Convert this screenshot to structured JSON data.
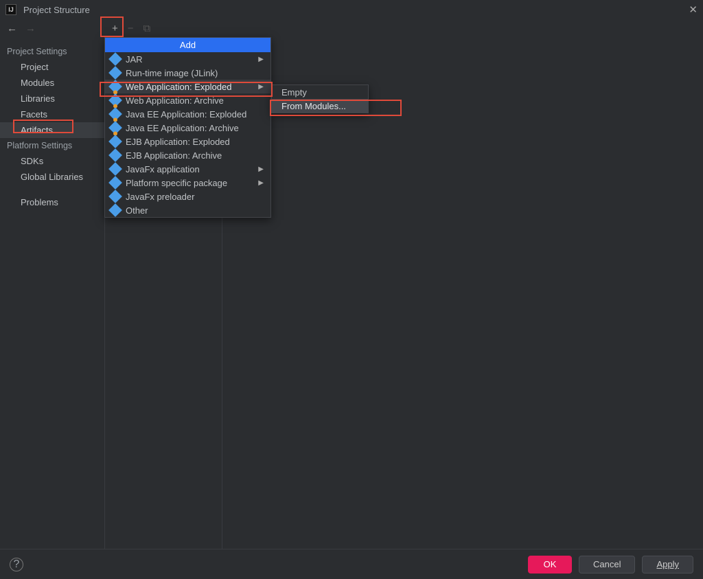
{
  "title": "Project Structure",
  "sidebar": {
    "heading1": "Project Settings",
    "heading2": "Platform Settings",
    "items1": [
      "Project",
      "Modules",
      "Libraries",
      "Facets",
      "Artifacts"
    ],
    "items2": [
      "SDKs",
      "Global Libraries"
    ],
    "problems": "Problems",
    "active": "Artifacts"
  },
  "menu": {
    "header": "Add",
    "items": [
      {
        "label": "JAR",
        "arrow": true,
        "orange": false
      },
      {
        "label": "Run-time image (JLink)",
        "arrow": false,
        "orange": false
      },
      {
        "label": "Web Application: Exploded",
        "arrow": true,
        "orange": true,
        "highlight": true
      },
      {
        "label": "Web Application: Archive",
        "arrow": false,
        "orange": true
      },
      {
        "label": "Java EE Application: Exploded",
        "arrow": false,
        "orange": true
      },
      {
        "label": "Java EE Application: Archive",
        "arrow": false,
        "orange": true
      },
      {
        "label": "EJB Application: Exploded",
        "arrow": false,
        "orange": false
      },
      {
        "label": "EJB Application: Archive",
        "arrow": false,
        "orange": false
      },
      {
        "label": "JavaFx application",
        "arrow": true,
        "orange": false
      },
      {
        "label": "Platform specific package",
        "arrow": true,
        "orange": false
      },
      {
        "label": "JavaFx preloader",
        "arrow": false,
        "orange": false
      },
      {
        "label": "Other",
        "arrow": false,
        "orange": false
      }
    ]
  },
  "submenu": {
    "items": [
      {
        "label": "Empty",
        "highlight": false
      },
      {
        "label": "From Modules...",
        "highlight": true
      }
    ]
  },
  "footer": {
    "ok": "OK",
    "cancel": "Cancel",
    "apply": "Apply"
  }
}
